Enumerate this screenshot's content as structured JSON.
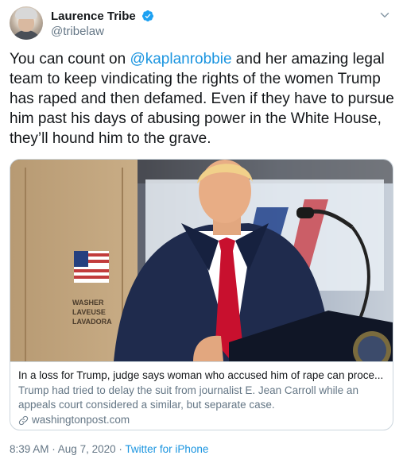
{
  "author": {
    "display_name": "Laurence Tribe",
    "handle": "@tribelaw",
    "verified": true
  },
  "tweet": {
    "text_before": "You can count on ",
    "mention": "@kaplanrobbie",
    "text_after": " and her amazing legal team to keep vindicating the rights of the women Trump has raped and then defamed. Even if they have to pursue him past his days of abusing power in the White House, they’ll hound him to the grave."
  },
  "card": {
    "title": "In a loss for Trump, judge says woman who accused him of rape can proce...",
    "description": "Trump had tried to delay the suit from journalist E. Jean Carroll while an appeals court considered a similar, but separate case.",
    "domain": "washingtonpost.com",
    "box_text": [
      "WASHER",
      "LAVEUSE",
      "LAVADORA"
    ]
  },
  "meta": {
    "time": "8:39 AM",
    "separator": " · ",
    "date": "Aug 7, 2020",
    "source": "Twitter for iPhone"
  },
  "icons": {
    "verified": "verified-badge-icon",
    "caret": "chevron-down-icon",
    "link": "link-icon"
  },
  "colors": {
    "accent": "#1b95e0",
    "secondary_text": "#657786",
    "border": "#ccd6dd"
  }
}
